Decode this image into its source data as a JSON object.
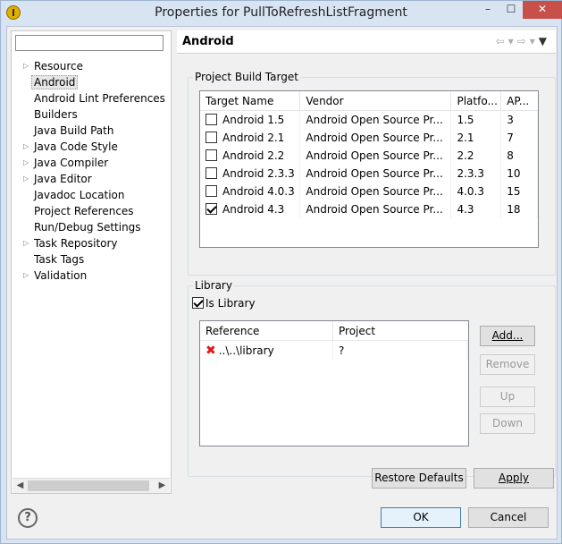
{
  "window": {
    "title": "Properties for PullToRefreshListFragment",
    "minimize": "–",
    "maximize": "☐",
    "close": "✕"
  },
  "filter": {
    "value": ""
  },
  "tree": [
    {
      "label": "Resource",
      "expandable": true
    },
    {
      "label": "Android",
      "expandable": false,
      "selected": true
    },
    {
      "label": "Android Lint Preferences",
      "expandable": false
    },
    {
      "label": "Builders",
      "expandable": false
    },
    {
      "label": "Java Build Path",
      "expandable": false
    },
    {
      "label": "Java Code Style",
      "expandable": true
    },
    {
      "label": "Java Compiler",
      "expandable": true
    },
    {
      "label": "Java Editor",
      "expandable": true
    },
    {
      "label": "Javadoc Location",
      "expandable": false
    },
    {
      "label": "Project References",
      "expandable": false
    },
    {
      "label": "Run/Debug Settings",
      "expandable": false
    },
    {
      "label": "Task Repository",
      "expandable": true
    },
    {
      "label": "Task Tags",
      "expandable": false
    },
    {
      "label": "Validation",
      "expandable": true
    }
  ],
  "page": {
    "title": "Android"
  },
  "build_target": {
    "group_label": "Project Build Target",
    "columns": [
      "Target Name",
      "Vendor",
      "Platfo...",
      "AP..."
    ],
    "rows": [
      {
        "name": "Android 1.5",
        "vendor": "Android Open Source Pr...",
        "platform": "1.5",
        "api": "3",
        "checked": false
      },
      {
        "name": "Android 2.1",
        "vendor": "Android Open Source Pr...",
        "platform": "2.1",
        "api": "7",
        "checked": false
      },
      {
        "name": "Android 2.2",
        "vendor": "Android Open Source Pr...",
        "platform": "2.2",
        "api": "8",
        "checked": false
      },
      {
        "name": "Android 2.3.3",
        "vendor": "Android Open Source Pr...",
        "platform": "2.3.3",
        "api": "10",
        "checked": false
      },
      {
        "name": "Android 4.0.3",
        "vendor": "Android Open Source Pr...",
        "platform": "4.0.3",
        "api": "15",
        "checked": false
      },
      {
        "name": "Android 4.3",
        "vendor": "Android Open Source Pr...",
        "platform": "4.3",
        "api": "18",
        "checked": true
      }
    ]
  },
  "library": {
    "group_label": "Library",
    "is_library_label": "Is Library",
    "is_library_checked": true,
    "columns": [
      "Reference",
      "Project"
    ],
    "rows": [
      {
        "reference": "..\\..\\library",
        "project": "?",
        "error": true
      }
    ],
    "add": "Add...",
    "remove": "Remove",
    "up": "Up",
    "down": "Down"
  },
  "buttons": {
    "restore_defaults": "Restore Defaults",
    "apply": "Apply",
    "ok": "OK",
    "cancel": "Cancel",
    "help": "?"
  }
}
